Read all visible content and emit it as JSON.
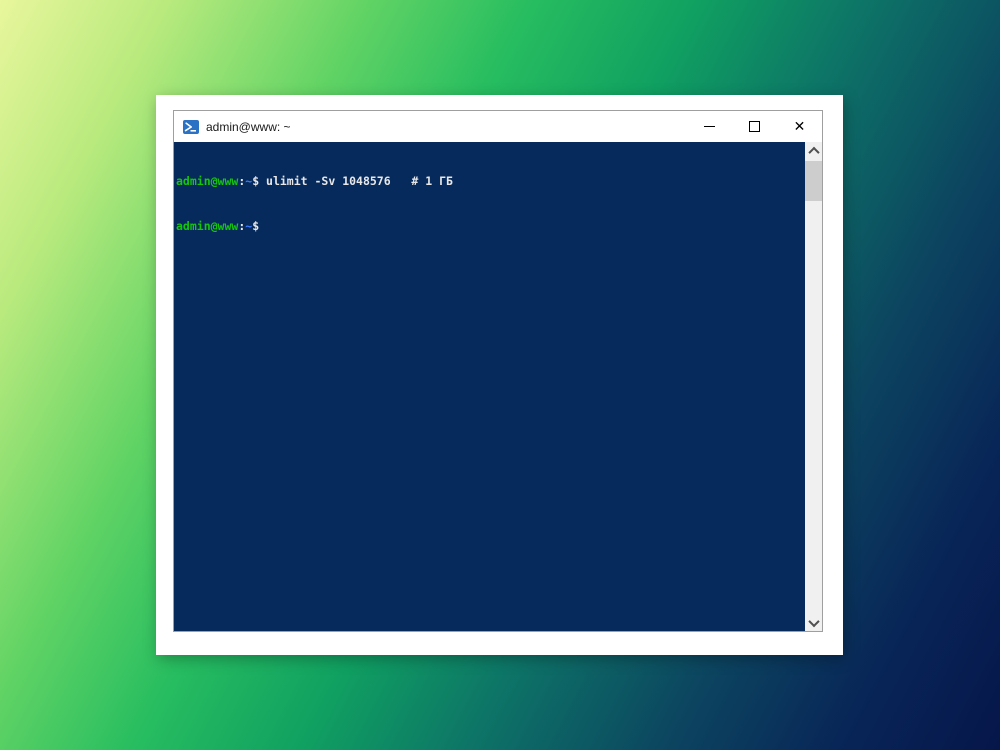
{
  "window": {
    "title": "admin@www: ~",
    "icon": "powershell-icon",
    "controls": {
      "minimize": "minimize",
      "maximize": "maximize",
      "close": "✕"
    }
  },
  "terminal": {
    "colors": {
      "background": "#072a5c",
      "user_green": "#16c60c",
      "path_blue": "#3b78ff",
      "text": "#e8e8e8"
    },
    "lines": [
      {
        "user": "admin@www",
        "sep": ":",
        "path": "~",
        "rest": "$ ulimit -Sv 1048576   # 1 ГБ"
      },
      {
        "user": "admin@www",
        "sep": ":",
        "path": "~",
        "rest": "$"
      }
    ]
  }
}
